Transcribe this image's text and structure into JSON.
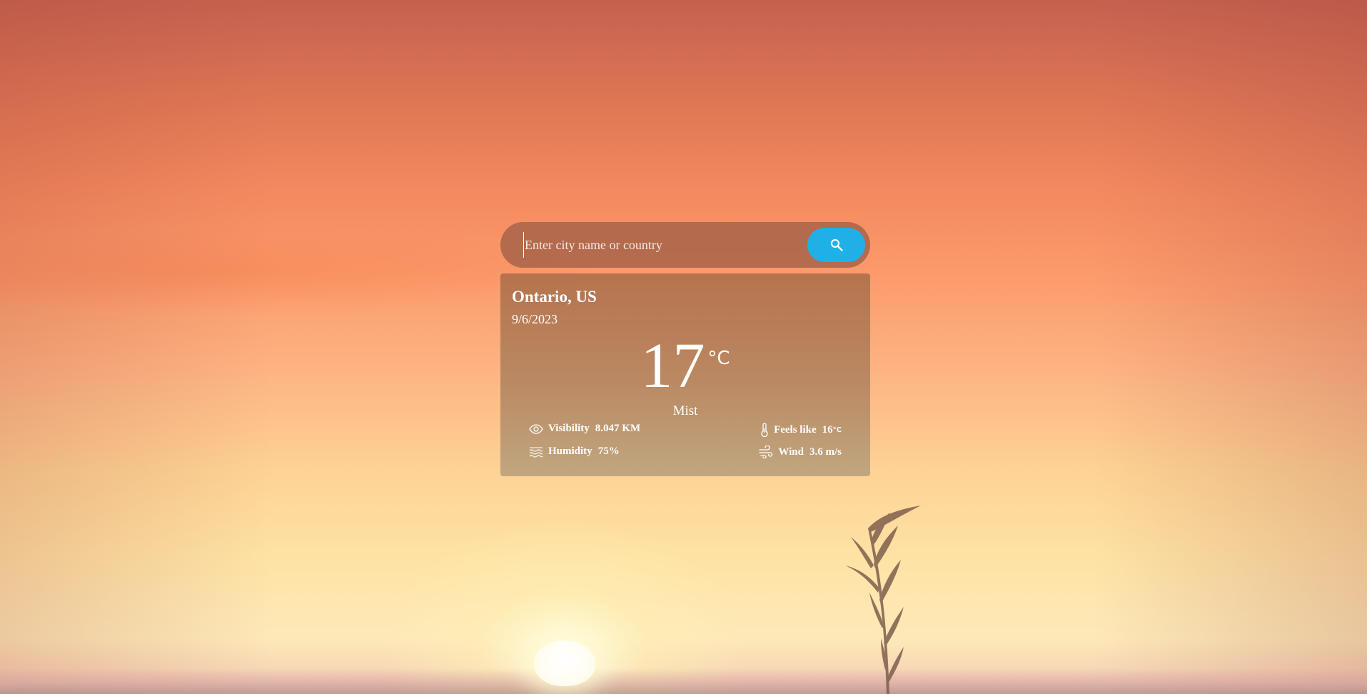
{
  "search": {
    "placeholder": "Enter city name or country",
    "value": ""
  },
  "icons": {
    "search_button": "search-icon",
    "visibility": "eye-icon",
    "humidity": "waves-icon",
    "feels_like": "thermometer-icon",
    "wind": "wind-icon"
  },
  "colors": {
    "search_button": "#20b0e8"
  },
  "weather": {
    "location": "Ontario, US",
    "date": "9/6/2023",
    "temperature": "17",
    "temperature_unit": "°C",
    "condition": "Mist",
    "visibility_label": "Visibility",
    "visibility_value": "8.047 KM",
    "humidity_label": "Humidity",
    "humidity_value": "75%",
    "feels_like_label": "Feels like",
    "feels_like_value": "16",
    "feels_like_unit": "°C",
    "wind_label": "Wind",
    "wind_value": "3.6 m/s"
  }
}
